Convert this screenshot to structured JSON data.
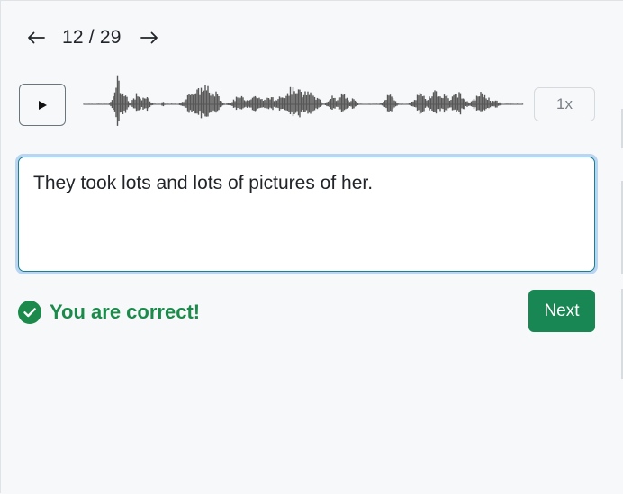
{
  "navigation": {
    "prev_icon": "arrow-left-icon",
    "next_icon": "arrow-right-icon",
    "counter": "12 / 29"
  },
  "player": {
    "play_icon": "play-icon",
    "speed_label": "1x"
  },
  "answer": {
    "value": "They took lots and lots of pictures of her."
  },
  "feedback": {
    "icon": "check-circle-icon",
    "message": "You are correct!",
    "color": "#1b8a4b"
  },
  "actions": {
    "next_label": "Next",
    "next_color": "#198754"
  }
}
